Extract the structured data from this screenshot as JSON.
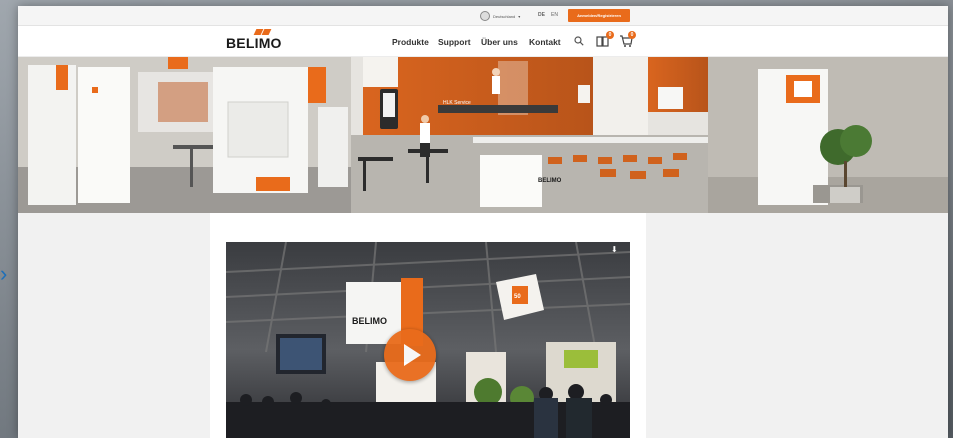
{
  "topbar": {
    "country": "Deutschland",
    "languages": [
      "DE",
      "EN"
    ],
    "cta_label": "Anmelden/Registrieren"
  },
  "brand": {
    "logo_text": "BELIMO"
  },
  "nav": {
    "items": [
      {
        "label": "Produkte"
      },
      {
        "label": "Support"
      },
      {
        "label": "Über uns"
      },
      {
        "label": "Kontakt"
      }
    ],
    "compare_count": "0",
    "cart_count": "0"
  },
  "hero": {
    "booth_sign": "BELIMO",
    "wall_label": "HLK Service"
  },
  "video": {
    "cube_text": "BELIMO",
    "cube_badge": "50"
  },
  "colors": {
    "accent": "#e96b1b",
    "page_bg": "#f1f1f1"
  }
}
